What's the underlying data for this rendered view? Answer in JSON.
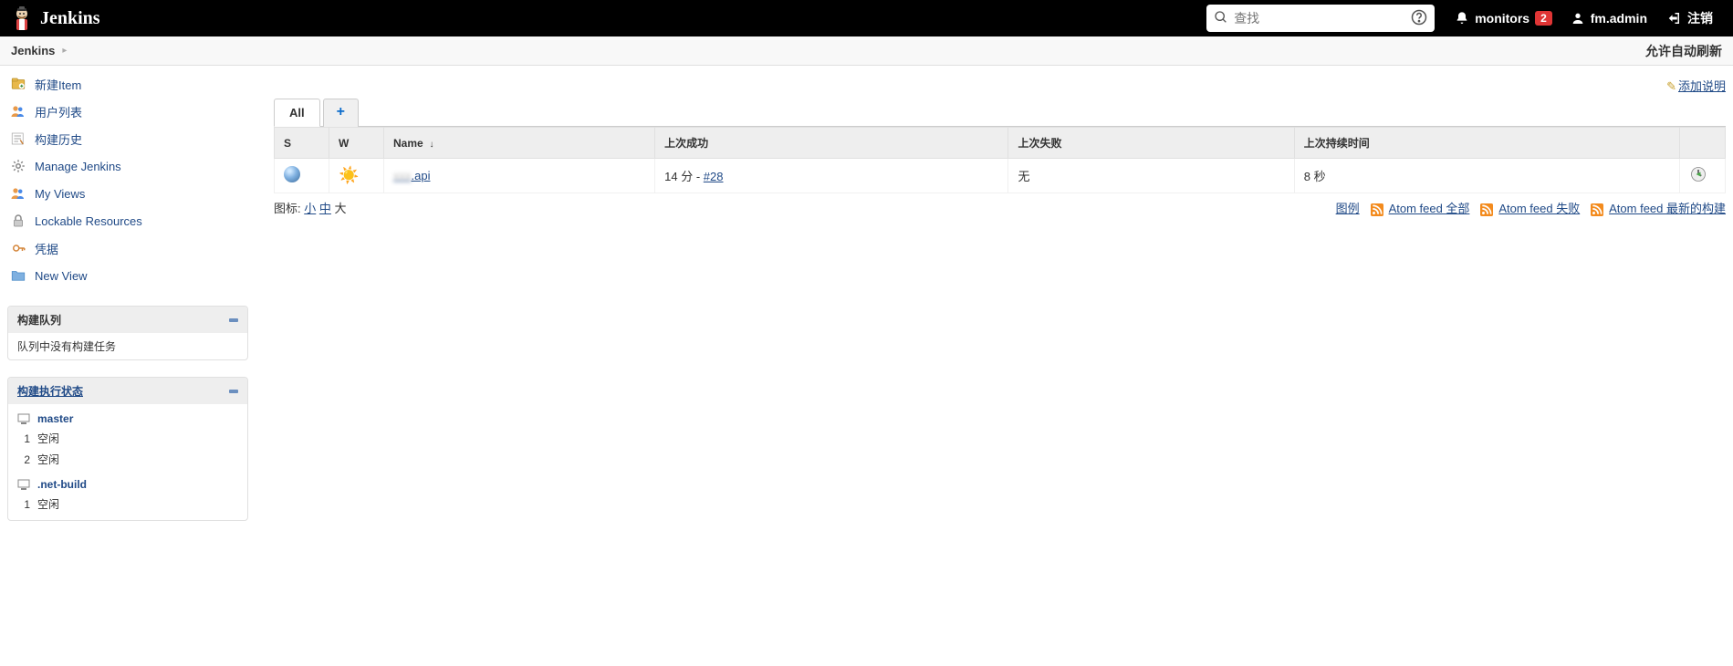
{
  "header": {
    "title": "Jenkins",
    "search_placeholder": "查找",
    "monitors_label": "monitors",
    "monitors_count": "2",
    "username": "fm.admin",
    "logout": "注销"
  },
  "breadcrumb": {
    "root": "Jenkins",
    "right_action": "允许自动刷新"
  },
  "side": {
    "tasks": [
      {
        "label": "新建Item",
        "name": "new-item"
      },
      {
        "label": "用户列表",
        "name": "people"
      },
      {
        "label": "构建历史",
        "name": "build-history"
      },
      {
        "label": "Manage Jenkins",
        "name": "manage-jenkins"
      },
      {
        "label": "My Views",
        "name": "my-views"
      },
      {
        "label": "Lockable Resources",
        "name": "lockable-resources"
      },
      {
        "label": "凭据",
        "name": "credentials"
      },
      {
        "label": "New View",
        "name": "new-view"
      }
    ],
    "build_queue": {
      "title": "构建队列",
      "empty": "队列中没有构建任务"
    },
    "executor_status": {
      "title": "构建执行状态",
      "nodes": [
        {
          "name": "master",
          "executors": [
            {
              "n": "1",
              "state": "空闲"
            },
            {
              "n": "2",
              "state": "空闲"
            }
          ]
        },
        {
          "name": ".net-build",
          "executors": [
            {
              "n": "1",
              "state": "空闲"
            }
          ]
        }
      ]
    }
  },
  "main": {
    "add_desc": "添加说明",
    "tabs": {
      "all": "All",
      "add": "+"
    },
    "columns": {
      "s": "S",
      "w": "W",
      "name": "Name",
      "last_success": "上次成功",
      "last_failure": "上次失败",
      "last_duration": "上次持续时间"
    },
    "jobs": [
      {
        "name_blur": "xxx",
        "name_suffix": ".api",
        "last_success_prefix": "14 分 - ",
        "last_success_build": "#28",
        "last_failure": "无",
        "last_duration": "8 秒"
      }
    ],
    "icon_size": {
      "label": "图标:",
      "small": "小",
      "medium": "中",
      "large": "大"
    },
    "legend": "图例",
    "feeds": {
      "all": "Atom feed 全部",
      "fail": "Atom feed 失败",
      "latest": "Atom feed 最新的构建"
    }
  }
}
